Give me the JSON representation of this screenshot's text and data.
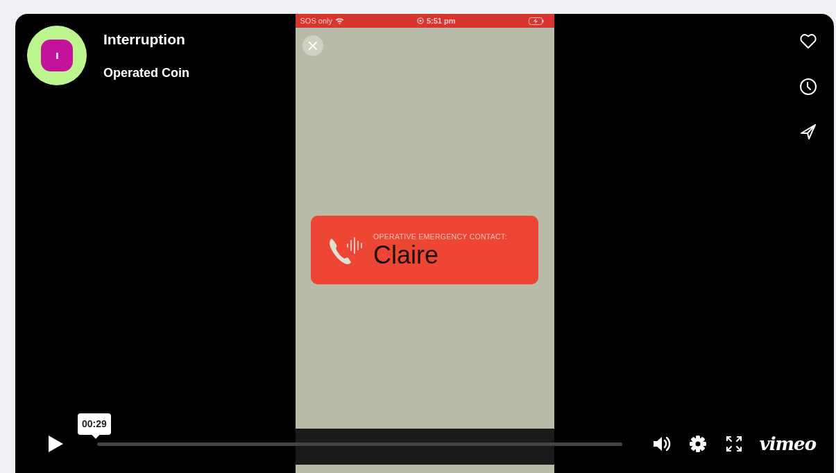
{
  "video": {
    "kind": "phone_recording",
    "status_bar": {
      "carrier": "SOS only",
      "time": "5:51 pm"
    },
    "alert": {
      "label": "OPERATIVE EMERGENCY CONTACT:",
      "name": "Claire"
    }
  },
  "header": {
    "title": "Interruption",
    "byline": "Operated Coin"
  },
  "side_actions": [
    {
      "kind": "like"
    },
    {
      "kind": "later"
    },
    {
      "kind": "share"
    }
  ],
  "controls": {
    "playing": false,
    "tooltip": "00:29",
    "brand": "vimeo"
  }
}
